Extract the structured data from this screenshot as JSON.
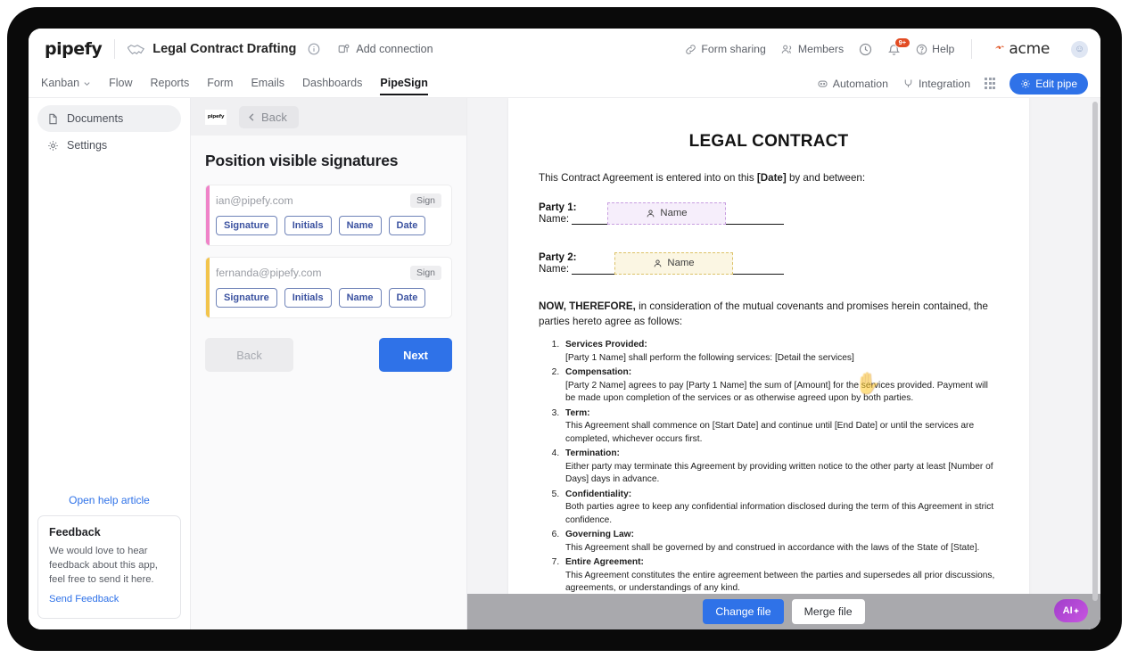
{
  "header": {
    "brand": "pipefy",
    "pipe_title": "Legal Contract Drafting",
    "info_icon": "info-circle-icon",
    "add_connection": "Add connection",
    "form_sharing": "Form sharing",
    "members": "Members",
    "clock_icon": "clock-icon",
    "bell_icon": "bell-icon",
    "bell_badge": "9+",
    "help": "Help",
    "org_name": "acme",
    "avatar_icon": "smiley-avatar"
  },
  "nav": {
    "tabs": [
      {
        "label": "Kanban",
        "active": false,
        "has_caret": true
      },
      {
        "label": "Flow",
        "active": false,
        "has_caret": false
      },
      {
        "label": "Reports",
        "active": false,
        "has_caret": false
      },
      {
        "label": "Form",
        "active": false,
        "has_caret": false
      },
      {
        "label": "Emails",
        "active": false,
        "has_caret": false
      },
      {
        "label": "Dashboards",
        "active": false,
        "has_caret": false
      },
      {
        "label": "PipeSign",
        "active": true,
        "has_caret": false
      }
    ],
    "automation": "Automation",
    "integration": "Integration",
    "apps_icon": "grid-apps-icon",
    "edit_pipe": "Edit pipe",
    "accent_color": "#2f72e8"
  },
  "sidebar": {
    "items": [
      {
        "label": "Documents",
        "icon": "document-icon",
        "active": true
      },
      {
        "label": "Settings",
        "icon": "gear-icon",
        "active": false
      }
    ],
    "help_link": "Open help article",
    "feedback": {
      "title": "Feedback",
      "body": "We would love to hear feedback about this app, feel free to send it here.",
      "link": "Send Feedback"
    }
  },
  "sigpanel": {
    "logo": "pipefy",
    "back_label": "Back",
    "title": "Position visible signatures",
    "signers": [
      {
        "email": "ian@pipefy.com",
        "sign_label": "Sign",
        "accent_color": "#ef83c8",
        "tags": [
          "Signature",
          "Initials",
          "Name",
          "Date"
        ]
      },
      {
        "email": "fernanda@pipefy.com",
        "sign_label": "Sign",
        "accent_color": "#f2c44c",
        "tags": [
          "Signature",
          "Initials",
          "Name",
          "Date"
        ]
      }
    ],
    "back_button": "Back",
    "next_button": "Next"
  },
  "document": {
    "title": "LEGAL CONTRACT",
    "intro_a": "This Contract Agreement is entered into on this ",
    "intro_b": "[Date]",
    "intro_c": " by and between:",
    "party1_label": "Party 1:",
    "party1_name_lead": "Name: ",
    "party1_field": "Name",
    "party2_label": "Party 2:",
    "party2_name_lead": "Name: ",
    "party2_field": "Name",
    "now_bold": "NOW, THEREFORE,",
    "now_rest": " in consideration of the mutual covenants and promises herein contained, the parties hereto agree as follows:",
    "clauses": [
      {
        "heading": "Services Provided:",
        "body": "[Party 1 Name] shall perform the following services: [Detail the services]"
      },
      {
        "heading": "Compensation:",
        "body": "[Party 2 Name] agrees to pay [Party 1 Name] the sum of [Amount] for the services provided. Payment will be made upon completion of the services or as otherwise agreed upon by both parties."
      },
      {
        "heading": "Term:",
        "body": "This Agreement shall commence on [Start Date] and continue until [End Date] or until the services are completed, whichever occurs first."
      },
      {
        "heading": "Termination:",
        "body": "Either party may terminate this Agreement by providing written notice to the other party at least [Number of Days] days in advance."
      },
      {
        "heading": "Confidentiality:",
        "body": "Both parties agree to keep any confidential information disclosed during the term of this Agreement in strict confidence."
      },
      {
        "heading": "Governing Law:",
        "body": "This Agreement shall be governed by and construed in accordance with the laws of the State of [State]."
      },
      {
        "heading": "Entire Agreement:",
        "body": "This Agreement constitutes the entire agreement between the parties and supersedes all prior discussions, agreements, or understandings of any kind."
      }
    ],
    "cursor_icon": "grab-hand-cursor"
  },
  "filebar": {
    "change_file": "Change file",
    "merge_file": "Merge file",
    "ai_button": "AI"
  }
}
